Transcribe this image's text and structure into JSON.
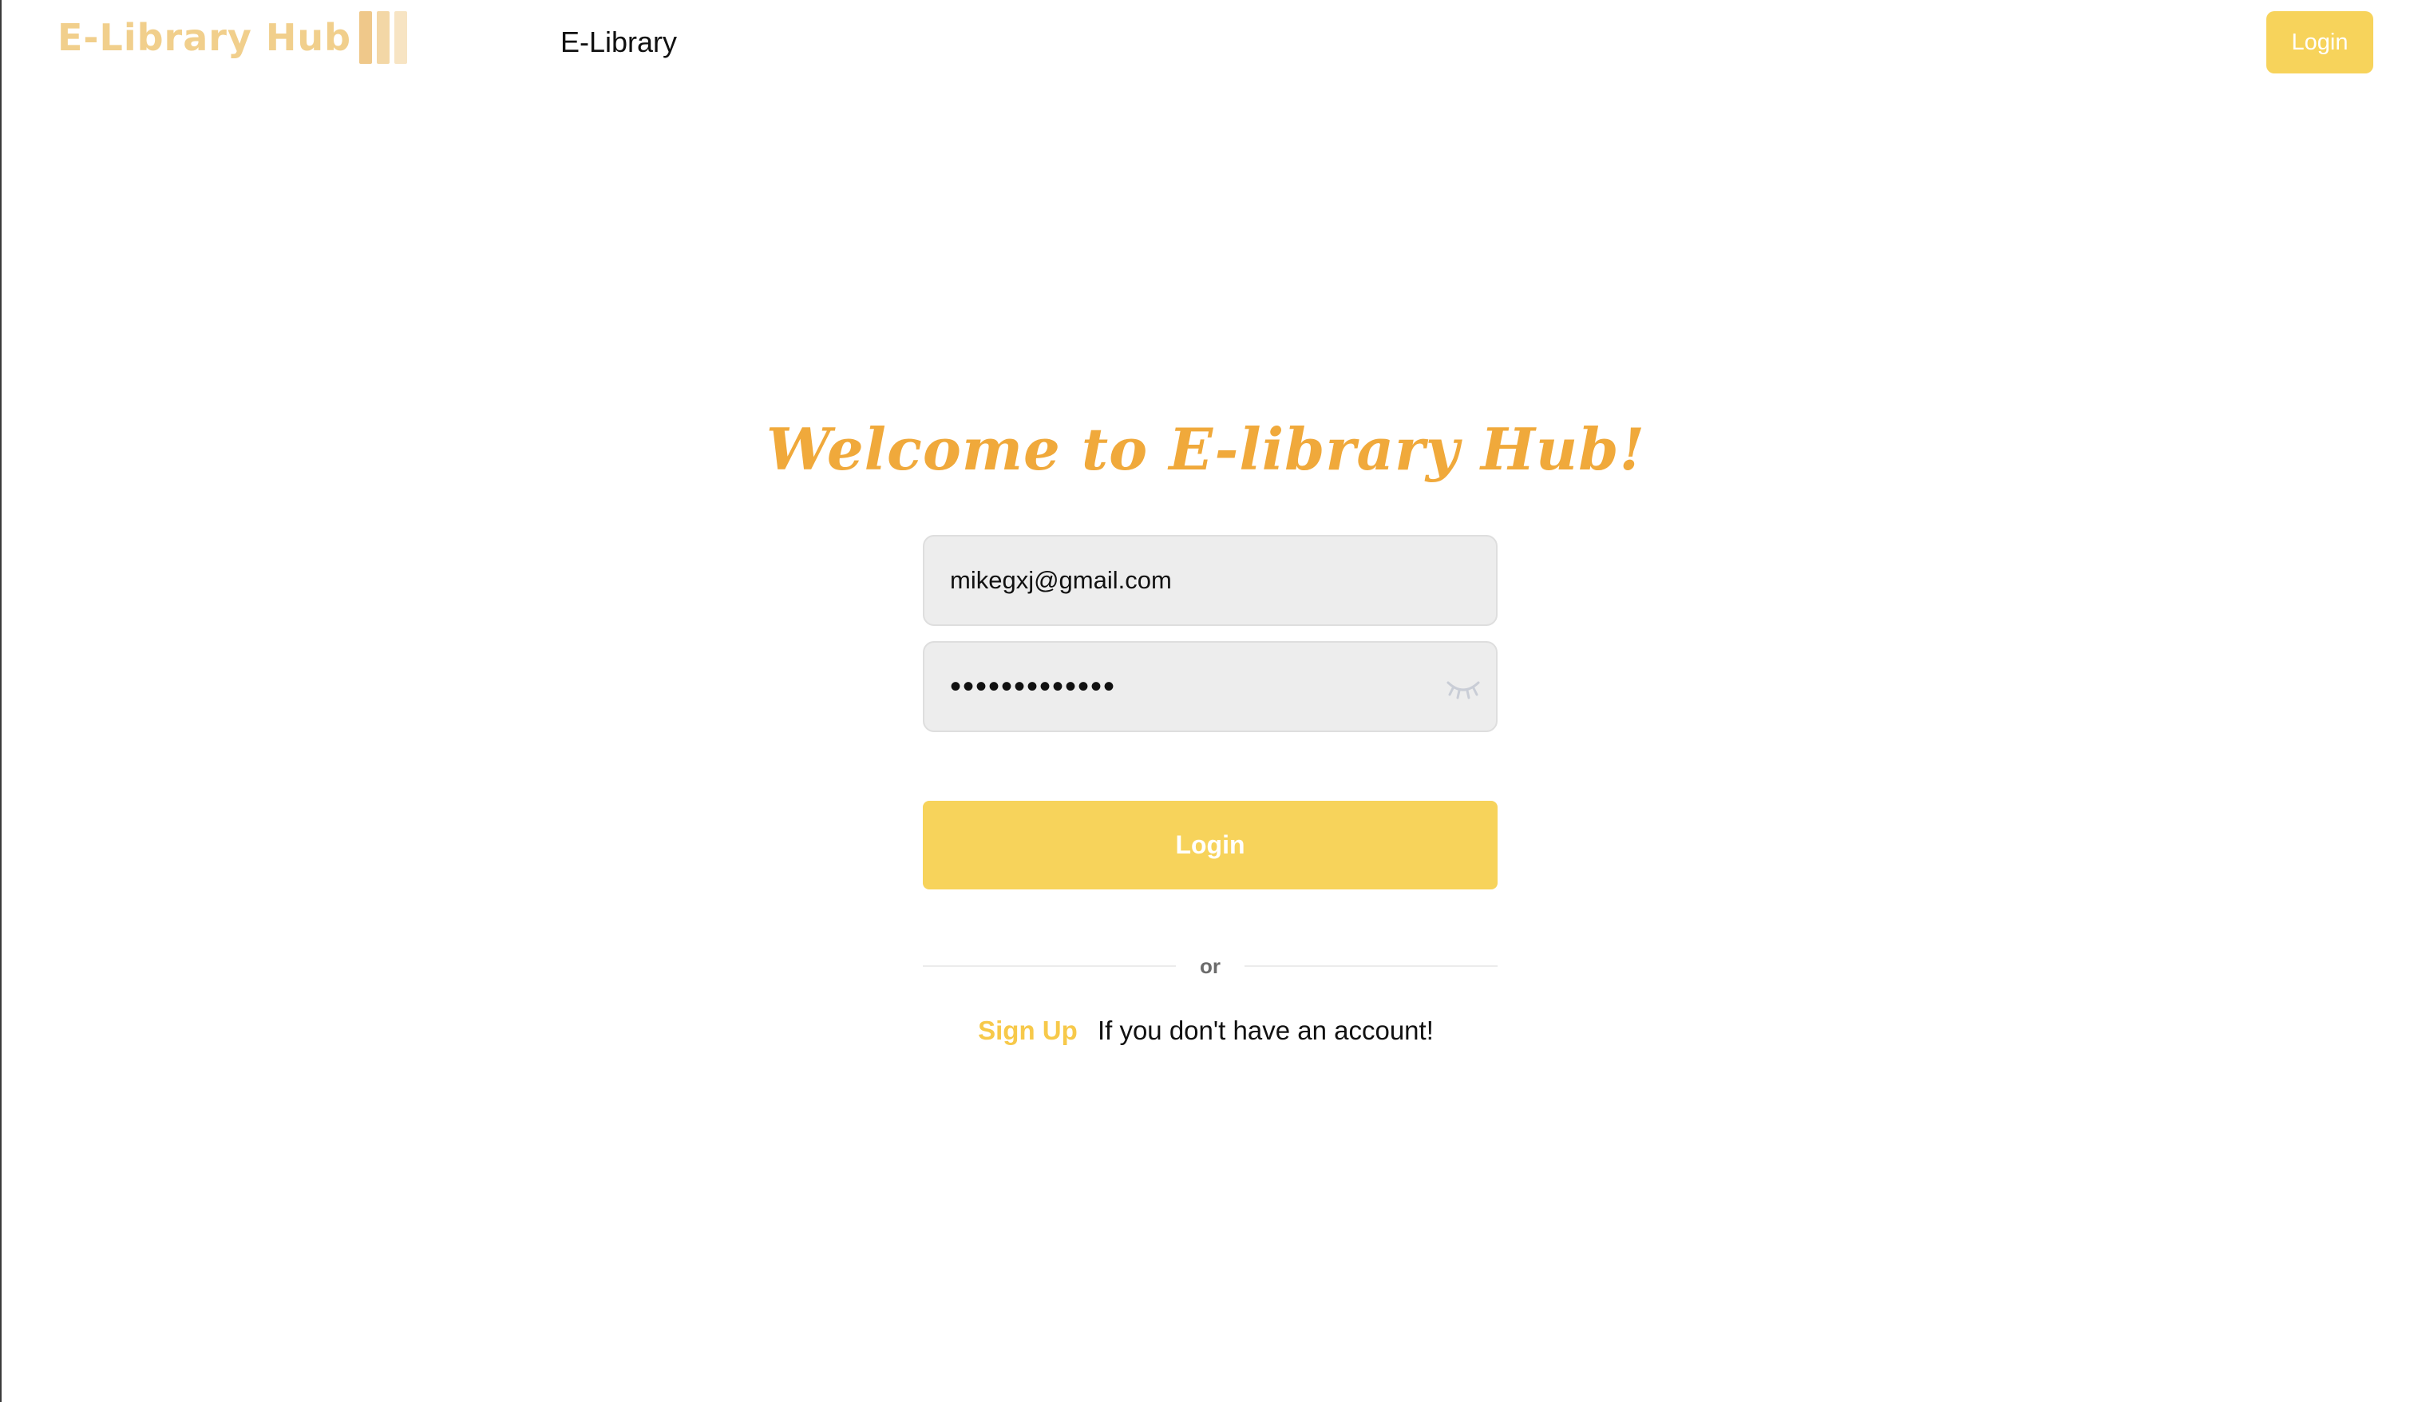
{
  "header": {
    "logo_text": "E-Library Hub",
    "nav_link": "E-Library",
    "login_label": "Login"
  },
  "main": {
    "welcome_title": "Welcome to E-library Hub!",
    "email_value": "mikegxj@gmail.com",
    "password_value": "•••••••••••••",
    "password_toggle_icon": "eye-closed-icon",
    "login_label": "Login",
    "divider_text": "or",
    "signup_link": "Sign Up",
    "signup_text": "If you don't have an account!"
  },
  "colors": {
    "accent": "#f7d35b",
    "title": "#f0a93b",
    "logo": "#f1cf8c",
    "signup_link": "#f7c94a",
    "input_bg": "#ededed"
  }
}
